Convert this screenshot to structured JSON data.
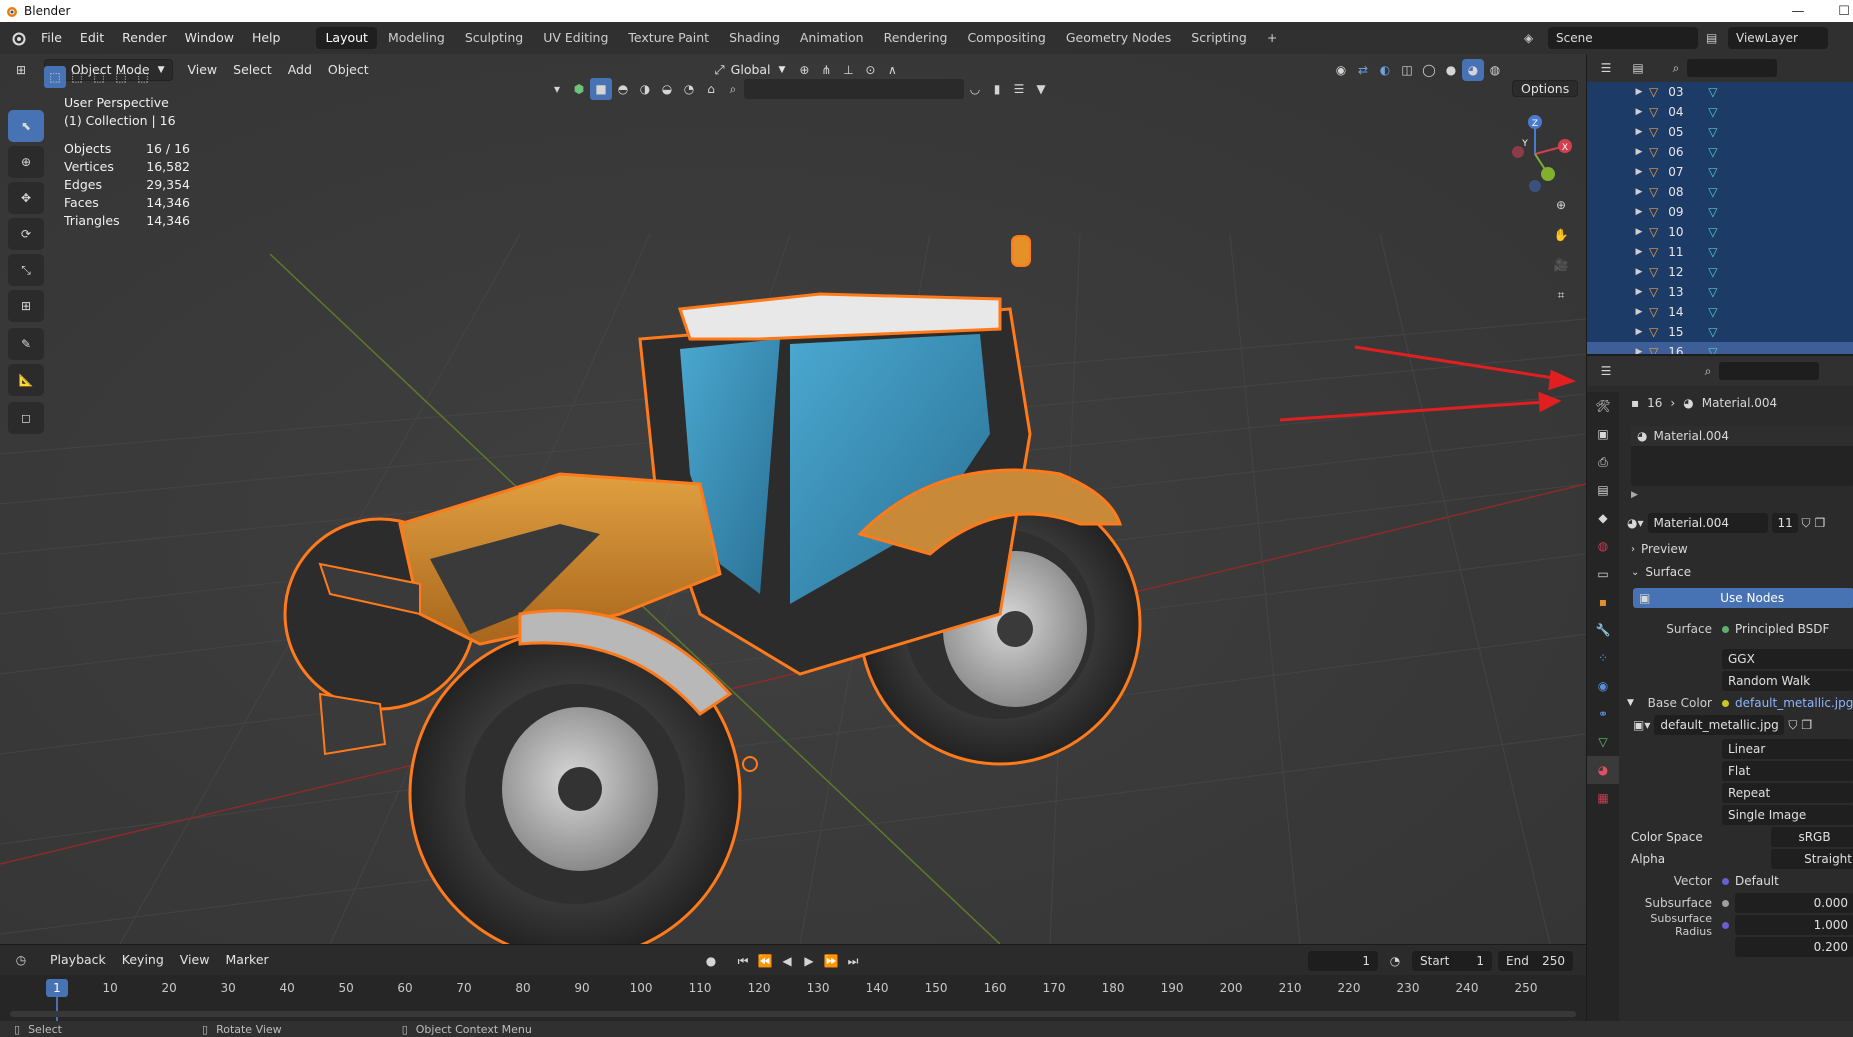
{
  "window": {
    "title": "Blender"
  },
  "menubar": {
    "menus": [
      "File",
      "Edit",
      "Render",
      "Window",
      "Help"
    ],
    "workspace_tabs": [
      "Layout",
      "Modeling",
      "Sculpting",
      "UV Editing",
      "Texture Paint",
      "Shading",
      "Animation",
      "Rendering",
      "Compositing",
      "Geometry Nodes",
      "Scripting"
    ],
    "active_tab": "Layout",
    "add_tab": "+",
    "scene": "Scene",
    "view_layer": "ViewLayer"
  },
  "viewport": {
    "mode": "Object Mode",
    "menus": [
      "View",
      "Select",
      "Add",
      "Object"
    ],
    "transform_orientation": "Global",
    "options_label": "Options",
    "perspective": "User Perspective",
    "collection": "(1) Collection | 16",
    "stats": [
      {
        "label": "Objects",
        "value": "16 / 16"
      },
      {
        "label": "Vertices",
        "value": "16,582"
      },
      {
        "label": "Edges",
        "value": "29,354"
      },
      {
        "label": "Faces",
        "value": "14,346"
      },
      {
        "label": "Triangles",
        "value": "14,346"
      }
    ],
    "gizmo_axes": {
      "z": "Z",
      "y": "Y",
      "x": "X"
    }
  },
  "timeline": {
    "menus": [
      "Playback",
      "Keying",
      "View",
      "Marker"
    ],
    "current_frame": "1",
    "start_label": "Start",
    "start": "1",
    "end_label": "End",
    "end": "250",
    "ticks": [
      "1",
      "10",
      "20",
      "30",
      "40",
      "50",
      "60",
      "70",
      "80",
      "90",
      "100",
      "110",
      "120",
      "130",
      "140",
      "150",
      "160",
      "170",
      "180",
      "190",
      "200",
      "210",
      "220",
      "230",
      "240",
      "250"
    ]
  },
  "statusbar": {
    "items": [
      "Select",
      "Rotate View",
      "Object Context Menu"
    ]
  },
  "outliner": {
    "items": [
      "03",
      "04",
      "05",
      "06",
      "07",
      "08",
      "09",
      "10",
      "11",
      "12",
      "13",
      "14",
      "15",
      "16"
    ],
    "selected": "16"
  },
  "properties": {
    "breadcrumb_object": "16",
    "breadcrumb_material": "Material.004",
    "slot_material": "Material.004",
    "material_name": "Material.004",
    "users": "11",
    "preview_label": "Preview",
    "surface_section": "Surface",
    "use_nodes": "Use Nodes",
    "surface_label": "Surface",
    "surface_value": "Principled BSDF",
    "distribution": "GGX",
    "subsurface_method": "Random Walk",
    "base_color_label": "Base Color",
    "base_color_value": "default_metallic.jpg",
    "image_name": "default_metallic.jpg",
    "interpolation": "Linear",
    "projection": "Flat",
    "extension": "Repeat",
    "source": "Single Image",
    "color_space_label": "Color Space",
    "color_space": "sRGB",
    "alpha_label": "Alpha",
    "alpha": "Straight",
    "vector_label": "Vector",
    "vector": "Default",
    "subsurface_label": "Subsurface",
    "subsurface": "0.000",
    "subsurface_radius_label": "Subsurface Radius",
    "subsurface_radius": [
      "1.000",
      "0.200"
    ]
  },
  "colors": {
    "accent_blue": "#4772b3",
    "selection_orange": "#ff7a1a",
    "annotation_red": "#e02020"
  }
}
